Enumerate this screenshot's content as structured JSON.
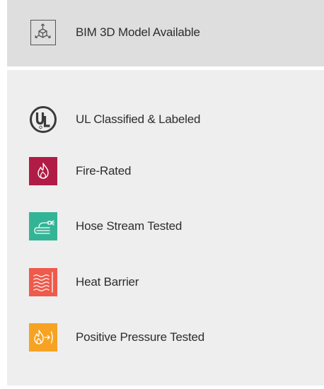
{
  "bim": {
    "label": "BIM 3D Model Available",
    "icon": "3d-model-icon"
  },
  "features": [
    {
      "label": "UL Classified & Labeled",
      "icon": "ul-logo-icon",
      "color": "#3a3a3a"
    },
    {
      "label": "Fire-Rated",
      "icon": "flame-icon",
      "color": "#b01c45"
    },
    {
      "label": "Hose Stream Tested",
      "icon": "hose-icon",
      "color": "#33b496"
    },
    {
      "label": "Heat Barrier",
      "icon": "heat-waves-icon",
      "color": "#ee5a4b"
    },
    {
      "label": "Positive Pressure Tested",
      "icon": "flame-arrow-icon",
      "color": "#f6a323"
    }
  ]
}
